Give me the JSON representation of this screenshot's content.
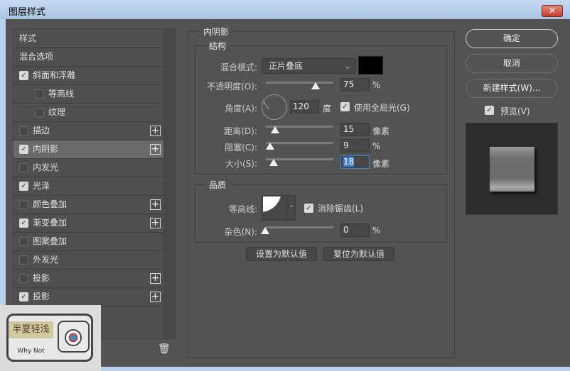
{
  "window": {
    "title": "图层样式",
    "close": "✕"
  },
  "list": {
    "items": [
      {
        "label": "样式",
        "checkbox": null,
        "plus": false
      },
      {
        "label": "混合选项",
        "checkbox": null,
        "plus": false
      },
      {
        "label": "斜面和浮雕",
        "checkbox": true,
        "plus": false
      },
      {
        "label": "等高线",
        "checkbox": false,
        "plus": false,
        "indent": true
      },
      {
        "label": "纹理",
        "checkbox": false,
        "plus": false,
        "indent": true
      },
      {
        "label": "描边",
        "checkbox": false,
        "plus": true
      },
      {
        "label": "内阴影",
        "checkbox": true,
        "plus": true,
        "selected": true
      },
      {
        "label": "内发光",
        "checkbox": false,
        "plus": false
      },
      {
        "label": "光泽",
        "checkbox": true,
        "plus": false
      },
      {
        "label": "颜色叠加",
        "checkbox": false,
        "plus": true
      },
      {
        "label": "渐变叠加",
        "checkbox": true,
        "plus": true
      },
      {
        "label": "图案叠加",
        "checkbox": false,
        "plus": false
      },
      {
        "label": "外发光",
        "checkbox": false,
        "plus": false
      },
      {
        "label": "投影",
        "checkbox": false,
        "plus": true
      },
      {
        "label": "投影",
        "checkbox": true,
        "plus": true
      }
    ],
    "trash_icon": "trash-icon"
  },
  "panel": {
    "title": "内阴影",
    "structure": {
      "title": "结构",
      "blend_label": "混合模式:",
      "blend_value": "正片叠底",
      "color": "#000000",
      "opacity_label": "不透明度(O):",
      "opacity": "75",
      "opacity_unit": "%",
      "angle_label": "角度(A):",
      "angle": "120",
      "angle_unit": "度",
      "global_light": "使用全局光(G)",
      "global_light_checked": true,
      "distance_label": "距离(D):",
      "distance": "15",
      "distance_unit": "像素",
      "choke_label": "阻塞(C):",
      "choke": "9",
      "choke_unit": "%",
      "size_label": "大小(S):",
      "size": "18",
      "size_unit": "像素"
    },
    "quality": {
      "title": "品质",
      "contour_label": "等高线:",
      "anti_alias": "消除锯齿(L)",
      "anti_alias_checked": true,
      "noise_label": "杂色(N):",
      "noise": "0",
      "noise_unit": "%"
    },
    "make_default": "设置为默认值",
    "reset_default": "复位为默认值"
  },
  "buttons": {
    "ok": "确定",
    "cancel": "取消",
    "new_style": "新建样式(W)...",
    "preview": "预览(V)",
    "preview_checked": true
  },
  "watermark": {
    "text": "半夏轻浅",
    "sub": "Why Not"
  }
}
